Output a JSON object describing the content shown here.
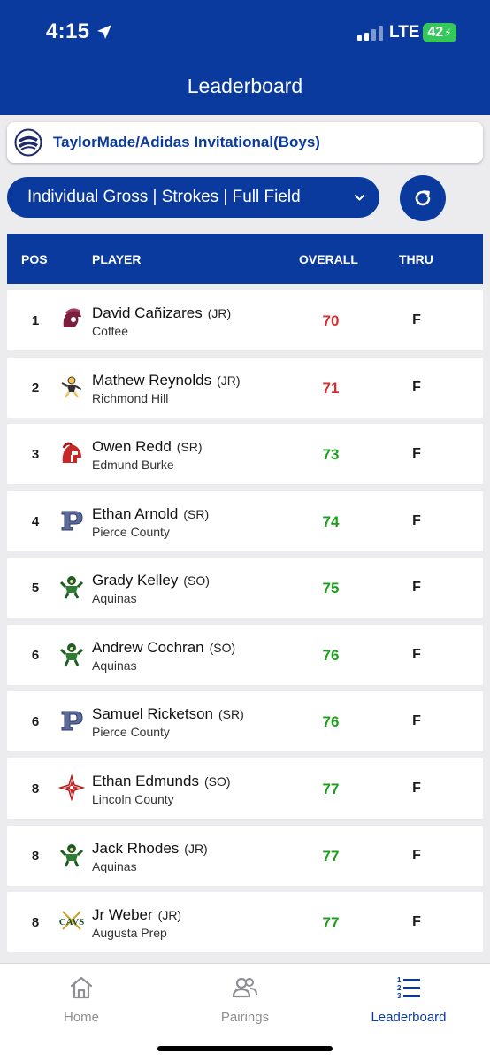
{
  "status_bar": {
    "time": "4:15",
    "network": "LTE",
    "battery": "42"
  },
  "header": {
    "title": "Leaderboard"
  },
  "event": {
    "title": "TaylorMade/Adidas Invitational(Boys)"
  },
  "filter": {
    "label": "Individual Gross | Strokes | Full Field"
  },
  "table": {
    "columns": {
      "pos": "POS",
      "player": "PLAYER",
      "overall": "OVERALL",
      "thru": "THRU"
    },
    "rows": [
      {
        "pos": "1",
        "name": "David Cañizares",
        "year": "(JR)",
        "team": "Coffee",
        "overall": "70",
        "thru": "F",
        "score_color": "#d32f2f",
        "logo": "trojan-icon"
      },
      {
        "pos": "2",
        "name": "Mathew Reynolds",
        "year": "(JR)",
        "team": "Richmond Hill",
        "overall": "71",
        "thru": "F",
        "score_color": "#d32f2f",
        "logo": "mascot-icon"
      },
      {
        "pos": "3",
        "name": "Owen Redd",
        "year": "(SR)",
        "team": "Edmund Burke",
        "overall": "73",
        "thru": "F",
        "score_color": "#1e9e1e",
        "logo": "spartan-icon"
      },
      {
        "pos": "4",
        "name": "Ethan Arnold",
        "year": "(SR)",
        "team": "Pierce County",
        "overall": "74",
        "thru": "F",
        "score_color": "#1e9e1e",
        "logo": "letter-p-icon"
      },
      {
        "pos": "5",
        "name": "Grady Kelley",
        "year": "(SO)",
        "team": "Aquinas",
        "overall": "75",
        "thru": "F",
        "score_color": "#1e9e1e",
        "logo": "irish-mascot-icon"
      },
      {
        "pos": "6",
        "name": "Andrew Cochran",
        "year": "(SO)",
        "team": "Aquinas",
        "overall": "76",
        "thru": "F",
        "score_color": "#1e9e1e",
        "logo": "irish-mascot-icon"
      },
      {
        "pos": "6",
        "name": "Samuel Ricketson",
        "year": "(SR)",
        "team": "Pierce County",
        "overall": "76",
        "thru": "F",
        "score_color": "#1e9e1e",
        "logo": "letter-p-icon"
      },
      {
        "pos": "8",
        "name": "Ethan Edmunds",
        "year": "(SO)",
        "team": "Lincoln County",
        "overall": "77",
        "thru": "F",
        "score_color": "#1e9e1e",
        "logo": "compass-star-icon"
      },
      {
        "pos": "8",
        "name": "Jack Rhodes",
        "year": "(JR)",
        "team": "Aquinas",
        "overall": "77",
        "thru": "F",
        "score_color": "#1e9e1e",
        "logo": "irish-mascot-icon"
      },
      {
        "pos": "8",
        "name": "Jr Weber",
        "year": "(JR)",
        "team": "Augusta Prep",
        "overall": "77",
        "thru": "F",
        "score_color": "#1e9e1e",
        "logo": "cavs-icon",
        "logo_text": "CAVS"
      }
    ]
  },
  "bottom_nav": {
    "home": "Home",
    "pairings": "Pairings",
    "leaderboard": "Leaderboard",
    "active": "leaderboard"
  },
  "colors": {
    "primary": "#0a3a9e",
    "over_par": "#d32f2f",
    "under_par": "#1e9e1e"
  }
}
